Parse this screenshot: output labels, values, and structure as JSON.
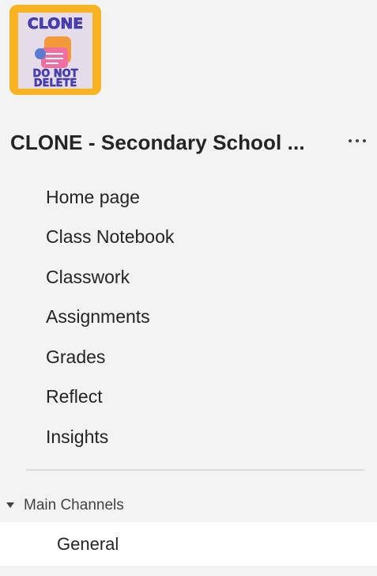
{
  "team": {
    "logo_top_text": "CLONE",
    "logo_bottom_line1": "DO NOT",
    "logo_bottom_line2": "DELETE",
    "name": "CLONE - Secondary School ...",
    "more_icon": "more-horizontal-icon"
  },
  "nav": {
    "items": [
      {
        "label": "Home page"
      },
      {
        "label": "Class Notebook"
      },
      {
        "label": "Classwork"
      },
      {
        "label": "Assignments"
      },
      {
        "label": "Grades"
      },
      {
        "label": "Reflect"
      },
      {
        "label": "Insights"
      }
    ]
  },
  "channels": {
    "section_label": "Main Channels",
    "section_icon": "caret-down-icon",
    "items": [
      {
        "label": "General",
        "selected": true
      }
    ]
  },
  "colors": {
    "background": "#f3f3f3",
    "logo_background": "#f7b321",
    "logo_text": "#4a3ec4",
    "selected_row": "#ffffff"
  }
}
